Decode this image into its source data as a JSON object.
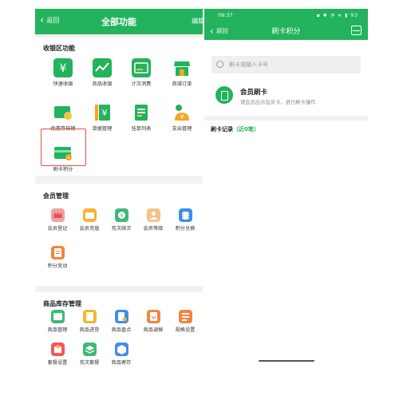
{
  "left": {
    "header": {
      "back": "返回",
      "title": "全部功能",
      "edit": "编辑"
    },
    "sections": [
      {
        "title": "收银区功能",
        "items": [
          {
            "label": "快速收银",
            "icon": "cashier-icon"
          },
          {
            "label": "商品收银",
            "icon": "chart-icon"
          },
          {
            "label": "计次消费",
            "icon": "count-icon"
          },
          {
            "label": "商城订单",
            "icon": "shop-icon"
          },
          {
            "label": "优惠券核销",
            "icon": "coupon-icon"
          },
          {
            "label": "单据管理",
            "icon": "bill-icon"
          },
          {
            "label": "挂单列表",
            "icon": "list-icon"
          },
          {
            "label": "支出管理",
            "icon": "expense-icon"
          },
          {
            "label": "刷卡积分",
            "icon": "card-points-icon"
          }
        ]
      },
      {
        "title": "会员管理",
        "items": [
          {
            "label": "会员登记",
            "icon": "crown-icon"
          },
          {
            "label": "会员充值",
            "icon": "wallet-icon"
          },
          {
            "label": "充次续次",
            "icon": "recharge-icon"
          },
          {
            "label": "会员等级",
            "icon": "level-icon"
          },
          {
            "label": "积分兑换",
            "icon": "coins-icon"
          },
          {
            "label": "积分变动",
            "icon": "points-change-icon"
          }
        ]
      },
      {
        "title": "商品库存管理",
        "items": [
          {
            "label": "商品管理",
            "icon": "box-icon"
          },
          {
            "label": "商品进货",
            "icon": "stock-in-icon"
          },
          {
            "label": "商品盘点",
            "icon": "inventory-icon"
          },
          {
            "label": "商品调拨",
            "icon": "transfer-icon"
          },
          {
            "label": "规格设置",
            "icon": "spec-icon"
          },
          {
            "label": "套餐设置",
            "icon": "package-icon"
          },
          {
            "label": "充次套餐",
            "icon": "layers-icon"
          },
          {
            "label": "商品寄存",
            "icon": "storage-icon"
          }
        ]
      }
    ]
  },
  "right": {
    "status": {
      "time": "09:37",
      "icons": "▪ ✱ ◔ ᯤ ▮ 93"
    },
    "header": {
      "back": "返回",
      "title": "刷卡积分"
    },
    "search": {
      "placeholder": "刷卡或输入卡号"
    },
    "card": {
      "title": "会员刷卡",
      "subtitle": "请会员出示会员卡，进行刷卡操作"
    },
    "records": {
      "label": "刷卡记录",
      "count": "（近0笔）"
    }
  },
  "colors": {
    "brand": "#22b35c",
    "highlight": "#e84a4a"
  }
}
